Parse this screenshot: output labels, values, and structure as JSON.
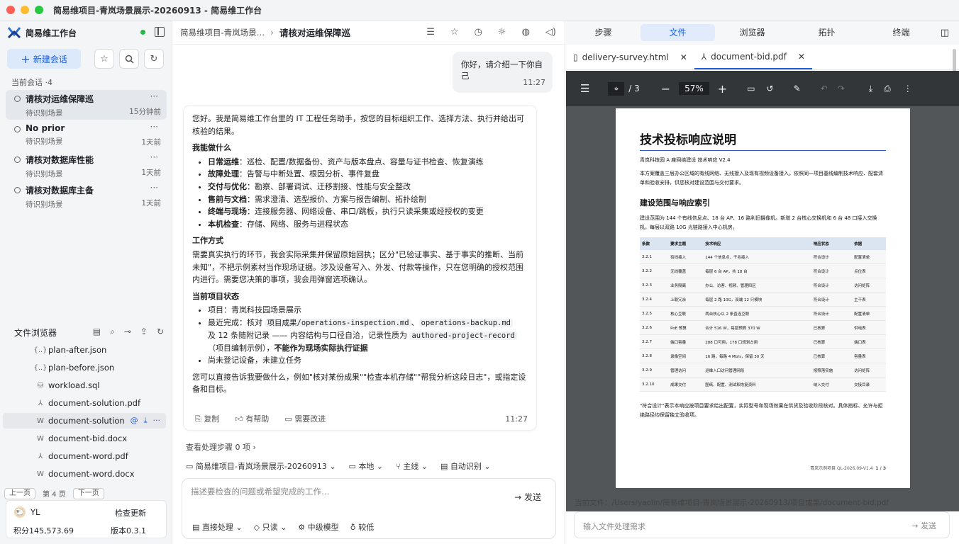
{
  "window": {
    "title": "简易维项目-青岚场景展示-20260913 - 简易维工作台"
  },
  "sidebar": {
    "app_name": "简易维工作台",
    "new_chat": "新建会话",
    "section_label": "当前会话 ·4",
    "sessions": [
      {
        "title": "请核对运维保障巡",
        "subtitle": "待识别场景",
        "time": "15分钟前"
      },
      {
        "title": "No prior",
        "subtitle": "待识别场景",
        "time": "1天前"
      },
      {
        "title": "请核对数据库性能",
        "subtitle": "待识别场景",
        "time": "1天前"
      },
      {
        "title": "请核对数据库主备",
        "subtitle": "待识别场景",
        "time": "1天前"
      }
    ],
    "file_browser_label": "文件浏览器",
    "files": [
      "plan-after.json",
      "plan-before.json",
      "workload.sql",
      "document-solution.pdf",
      "document-solution",
      "document-bid.docx",
      "document-word.pdf",
      "document-word.docx"
    ],
    "pager": {
      "prev": "上一页",
      "page": "第 4 页",
      "next": "下一页"
    },
    "user": {
      "name": "YL",
      "check_update": "检查更新",
      "points": "积分145,573.69",
      "version": "版本0.3.1"
    }
  },
  "chat": {
    "crumb_project": "简易维项目-青岚场景…",
    "crumb_title": "请核对运维保障巡",
    "user_msg": "你好，请介绍一下你自己",
    "user_time": "11:27",
    "ai": {
      "intro": "您好。我是简易维工作台里的 IT 工程任务助手，按您的目标组织工作、选择方法、执行并给出可核验的结果。",
      "h_can": "我能做什么",
      "can": [
        {
          "k": "日常运维",
          "v": "：巡检、配置/数据备份、资产与版本盘点、容量与证书检查、恢复演练"
        },
        {
          "k": "故障处理",
          "v": "：告警与中断处置、根因分析、事件复盘"
        },
        {
          "k": "交付与优化",
          "v": "：勘察、部署调试、迁移割接、性能与安全整改"
        },
        {
          "k": "售前与文档",
          "v": "：需求澄清、选型报价、方案与报告编制、拓扑绘制"
        },
        {
          "k": "终端与现场",
          "v": "：连接服务器、网络设备、串口/跳板，执行只读采集或经授权的变更"
        },
        {
          "k": "本机检查",
          "v": "：存储、网络、服务与进程状态"
        }
      ],
      "h_way": "工作方式",
      "way": "需要真实执行的环节，我会实际采集并保留原始回执；区分\"已验证事实、基于事实的推断、当前未知\"，不把示例素材当作现场证据。涉及设备写入、外发、付款等操作，只在您明确的授权范围内进行。需要您决策的事项，我会用弹窗选项确认。",
      "h_status": "当前项目状态",
      "s1": "项目：青岚科技园场景展示",
      "s2a": "最近完成：核对 ",
      "s2b": "项目成果/operations-inspection.md",
      "s2c": "operations-backup.md",
      "s2d": "及 12 条随附记录 —— 内容结构与口径自洽，记录性质为 ",
      "s2e": "authored-project-record",
      "s2f": "（项目编制示例），",
      "s2g": "不能作为现场实际执行证据",
      "s3": "尚未登记设备，未建立任务",
      "outro": "您可以直接告诉我要做什么，例如\"核对某份成果\"\"检查本机存储\"\"帮我分析这段日志\"，或指定设备和目标。",
      "copy": "复制",
      "helpful": "有帮助",
      "improve": "需要改进",
      "time": "11:27"
    },
    "steps": "查看处理步骤 0 项 ›",
    "ctx": {
      "project": "简易维项目-青岚场景展示-20260913",
      "local": "本地",
      "branch": "主线",
      "auto": "自动识别"
    },
    "input_ph": "描述要检查的问题或希望完成的工作…",
    "send": "发送",
    "opts": {
      "mode": "直接处理",
      "perm": "只读",
      "model": "中级模型",
      "effort": "较低"
    }
  },
  "right": {
    "tabs": [
      "步骤",
      "文件",
      "浏览器",
      "拓扑",
      "终端"
    ],
    "file_tabs": [
      "delivery-survey.html",
      "document-bid.pdf"
    ],
    "pdf": {
      "page": "/ 3",
      "zoom": "57%"
    },
    "doc": {
      "title": "技术投标响应说明",
      "meta": "青岚科技园 A 座网络建设  技术响应 V2.4",
      "intro": "本方案覆盖三层办公区域的有线网络、无线接入及现有视频设备接入。依照同一项目基线编制技术响应、配套清单和验收安排，供您核对建设范围与交付要求。",
      "h2": "建设范围与响应索引",
      "scope": "建设范围为 144 个有线信息点、18 台 AP、16 路利旧摄像机。新增 2 台核心交换机和 6 台 48 口接入交换机，每层以双路 10G 光链路接入中心机房。",
      "headers": [
        "条款",
        "要求主题",
        "技术响应",
        "响应状态",
        "依据"
      ],
      "rows": [
        [
          "3.2.1",
          "有线接入",
          "144 个信息点，千兆接入",
          "符合设计",
          "配置清单"
        ],
        [
          "3.2.2",
          "无线覆盖",
          "每层 6 台 AP，共 18 台",
          "符合设计",
          "点位表"
        ],
        [
          "3.2.3",
          "业务隔离",
          "办公、访客、视频、管理四区",
          "符合设计",
          "访问矩阵"
        ],
        [
          "3.2.4",
          "上联冗余",
          "每层 2 路 10G，双端 12 只模块",
          "符合设计",
          "主干表"
        ],
        [
          "3.2.5",
          "核心互联",
          "两台核心以 2 条直连互联",
          "符合设计",
          "配置清单"
        ],
        [
          "3.2.6",
          "PoE 预算",
          "合计 516 W，每层预算 370 W",
          "已核算",
          "供电表"
        ],
        [
          "3.2.7",
          "端口容量",
          "288 口可用，178 口规划占用",
          "已核算",
          "端口表"
        ],
        [
          "3.2.8",
          "录像空间",
          "16 路，每路 4 Mb/s，保留 30 天",
          "已核算",
          "容量表"
        ],
        [
          "3.2.9",
          "管理访问",
          "运维入口访问管理网段",
          "按照落实施",
          "访问矩阵"
        ],
        [
          "3.2.10",
          "成果交付",
          "图纸、配置、测试和恢复资料",
          "纳入交付",
          "交接目录"
        ]
      ],
      "note": "\"符合设计\"表示本响应按项目要求给出配置，实际型号和现场效果在供货及验收阶段核对。具体指标、允许与拒绝路径均保留独立验收项。",
      "footer_id": "青岚示例项目 QL-2026.09-V1.4",
      "footer_page": "1 / 3"
    },
    "current_file": "当前文件：/Users/yaolin/简易维项目-青岚场景展示-20260913/项目成果/document-bid.pdf",
    "input_ph": "输入文件处理需求",
    "send": "发送"
  }
}
